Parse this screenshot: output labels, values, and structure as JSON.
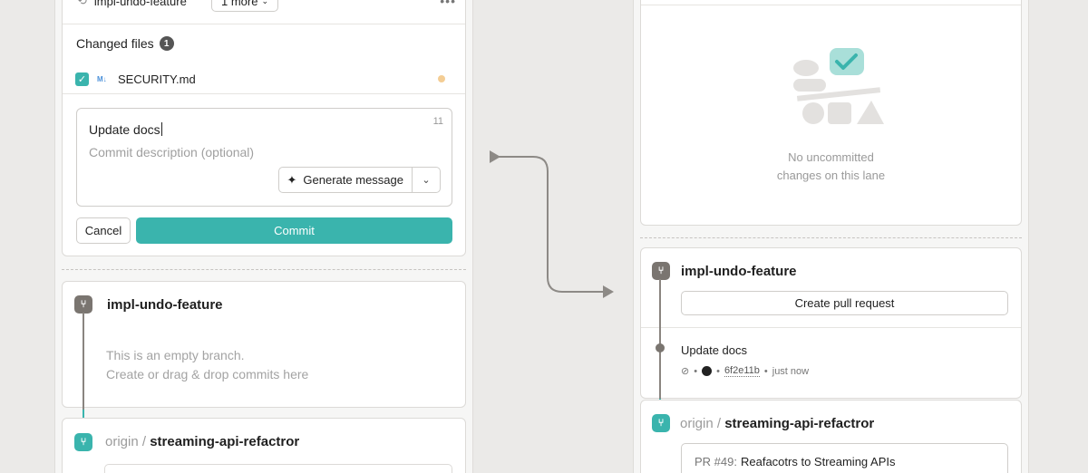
{
  "left": {
    "tab_branch": "impl-undo-feature",
    "tab_more": "1 more",
    "changed_files_label": "Changed files",
    "changed_files_count": "1",
    "file_type": "M↓",
    "file_name": "SECURITY.md",
    "commit_title": "Update docs",
    "char_count": "11",
    "commit_description_placeholder": "Commit description (optional)",
    "generate_label": "Generate message",
    "cancel_label": "Cancel",
    "commit_label": "Commit",
    "branch_name": "impl-undo-feature",
    "empty_line1": "This is an empty branch.",
    "empty_line2": "Create or drag & drop commits here",
    "origin_prefix": "origin /",
    "origin_branch": "streaming-api-refactror"
  },
  "right": {
    "empty_line1": "No uncommitted",
    "empty_line2": "changes on this lane",
    "branch_name": "impl-undo-feature",
    "pr_button": "Create pull request",
    "commit_title": "Update docs",
    "commit_sha": "6f2e11b",
    "commit_time": "just now",
    "origin_prefix": "origin /",
    "origin_branch": "streaming-api-refactror",
    "pr_number": "PR #49:",
    "pr_title": "Reafacotrs to Streaming APIs"
  },
  "colors": {
    "accent": "#3ab4ad",
    "branch_gray": "#7a7570",
    "modified_dot": "#f4cd94"
  }
}
